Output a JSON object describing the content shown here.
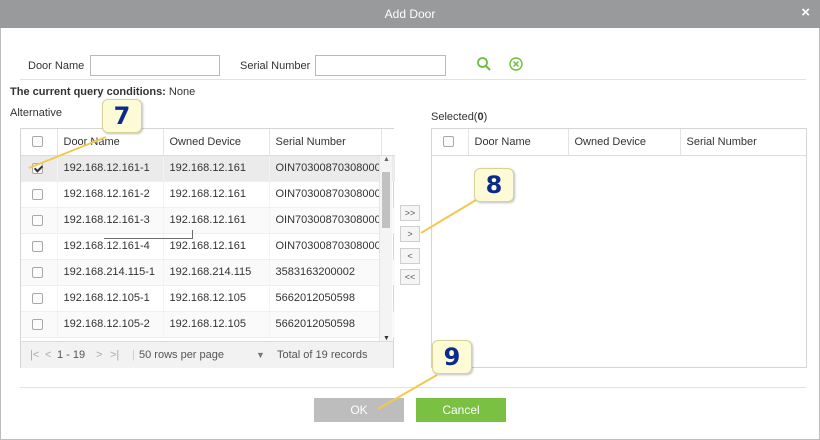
{
  "dialog": {
    "title": "Add Door",
    "close_glyph": "×"
  },
  "query": {
    "door_name_label": "Door Name",
    "door_name_value": "",
    "serial_number_label": "Serial Number",
    "serial_number_value": "",
    "conditions_label": "The current query conditions:",
    "conditions_value": "None"
  },
  "alternative": {
    "title": "Alternative",
    "columns": [
      "Door Name",
      "Owned Device",
      "Serial Number"
    ],
    "rows": [
      {
        "checked": true,
        "door": "192.168.12.161-1",
        "device": "192.168.12.161",
        "serial": "OIN70300870308000"
      },
      {
        "checked": false,
        "door": "192.168.12.161-2",
        "device": "192.168.12.161",
        "serial": "OIN70300870308000"
      },
      {
        "checked": false,
        "door": "192.168.12.161-3",
        "device": "192.168.12.161",
        "serial": "OIN70300870308000"
      },
      {
        "checked": false,
        "door": "192.168.12.161-4",
        "device": "192.168.12.161",
        "serial": "OIN70300870308000"
      },
      {
        "checked": false,
        "door": "192.168.214.115-1",
        "device": "192.168.214.115",
        "serial": "3583163200002"
      },
      {
        "checked": false,
        "door": "192.168.12.105-1",
        "device": "192.168.12.105",
        "serial": "5662012050598"
      },
      {
        "checked": false,
        "door": "192.168.12.105-2",
        "device": "192.168.12.105",
        "serial": "5662012050598"
      }
    ],
    "pager": {
      "first": "|<",
      "prev": "<",
      "range": "1 - 19",
      "next": ">",
      "last": ">|",
      "page_size": "50 rows per page",
      "total": "Total of 19 records"
    }
  },
  "move_buttons": {
    "add_all": ">>",
    "add": ">",
    "remove": "<",
    "remove_all": "<<"
  },
  "selected": {
    "title_prefix": "Selected(",
    "count": "0",
    "title_suffix": ")",
    "columns": [
      "Door Name",
      "Owned Device",
      "Serial Number"
    ]
  },
  "buttons": {
    "ok": "OK",
    "cancel": "Cancel"
  },
  "callouts": {
    "a": "7",
    "b": "8",
    "c": "9"
  },
  "colors": {
    "titlebar": "#999a9c",
    "ok": "#bdbdbd",
    "cancel": "#7ac143",
    "icon_green": "#6bbf3a",
    "callout_text": "#0a2a8c",
    "callout_bg": "#fdfbd6",
    "leader_line": "#f2c94c"
  },
  "icons": [
    "search-icon",
    "clear-icon",
    "close-icon",
    "dropdown-arrow-icon",
    "scroll-up-icon",
    "scroll-down-icon"
  ]
}
